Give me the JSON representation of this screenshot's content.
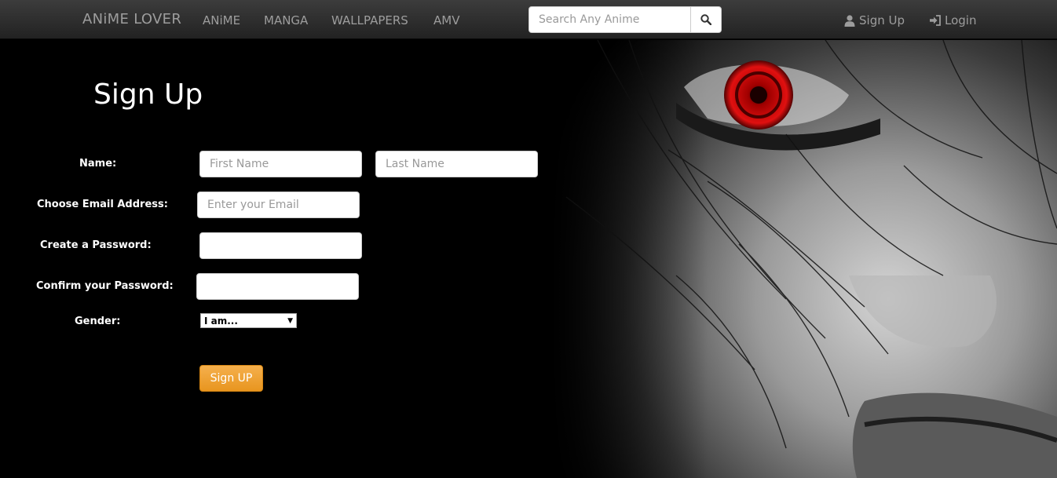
{
  "navbar": {
    "brand": "ANiME LOVER",
    "links": [
      "ANiME",
      "MANGA",
      "WALLPAPERS",
      "AMV"
    ],
    "search_placeholder": "Search Any Anime",
    "signup_label": "Sign Up",
    "login_label": "Login"
  },
  "form": {
    "title": "Sign Up",
    "name_label": "Name:",
    "first_name_placeholder": "First Name",
    "last_name_placeholder": "Last Name",
    "email_label": "Choose Email Address:",
    "email_placeholder": "Enter your Email",
    "password_label": "Create a Password:",
    "confirm_label": "Confirm your Password:",
    "gender_label": "Gender:",
    "gender_selected": "I am...",
    "submit_label": "Sign UP"
  },
  "colors": {
    "navbar": "#2f2f2f",
    "background": "#000000",
    "button": "#f0a030"
  }
}
